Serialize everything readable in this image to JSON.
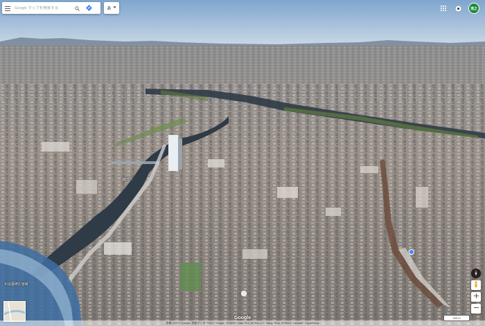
{
  "search": {
    "placeholder": "Google マップを検索する"
  },
  "layer_chip": {
    "label": "あ"
  },
  "account": {
    "initial": "浩之"
  },
  "map_labels": [
    {
      "text": "隅田川"
    },
    {
      "text": "石造墓碑お宮跡"
    }
  ],
  "footer": {
    "logo": "Google",
    "attribution": "画像 ©2017 Google, 地図データ ©2017 Google, ZENRIN, Data SIO, NOAA, U.S. Navy, NGA, GEBCO, Landsat / Copernicus",
    "scale_label": "200 m"
  },
  "colors": {
    "sky_top": "#7fa6cf",
    "sky_bottom": "#cfdbe6",
    "river": "#2f3b46",
    "city": "#8f8a85",
    "accent_blue": "#4285f4",
    "avatar_green": "#1b8a3a"
  }
}
